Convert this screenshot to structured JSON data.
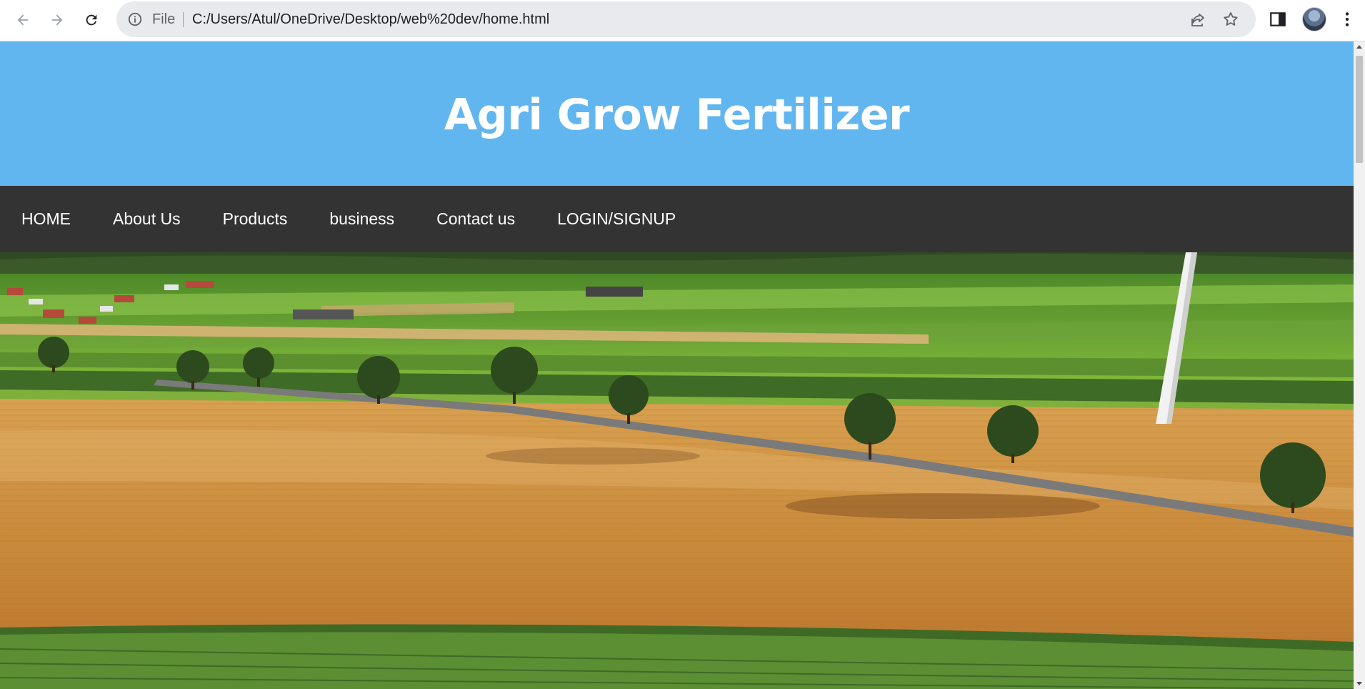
{
  "browser": {
    "file_label": "File",
    "url": "C:/Users/Atul/OneDrive/Desktop/web%20dev/home.html",
    "icons": {
      "back": "arrow-left-icon",
      "forward": "arrow-right-icon",
      "reload": "reload-icon",
      "info": "info-icon",
      "share": "share-icon",
      "bookmark": "star-icon",
      "side_panel": "side-panel-icon",
      "profile": "avatar",
      "menu": "kebab-menu-icon"
    }
  },
  "site": {
    "title": "Agri Grow Fertilizer",
    "nav": [
      {
        "label": "HOME"
      },
      {
        "label": "About Us"
      },
      {
        "label": "Products"
      },
      {
        "label": "business"
      },
      {
        "label": "Contact us"
      },
      {
        "label": "LOGIN/SIGNUP"
      }
    ],
    "hero_image": "aerial farmland fields with trees, road and wind turbine"
  },
  "colors": {
    "header_bg": "#62b6f0",
    "nav_bg": "#333333",
    "title_color": "#ffffff",
    "nav_text": "#ffffff"
  }
}
